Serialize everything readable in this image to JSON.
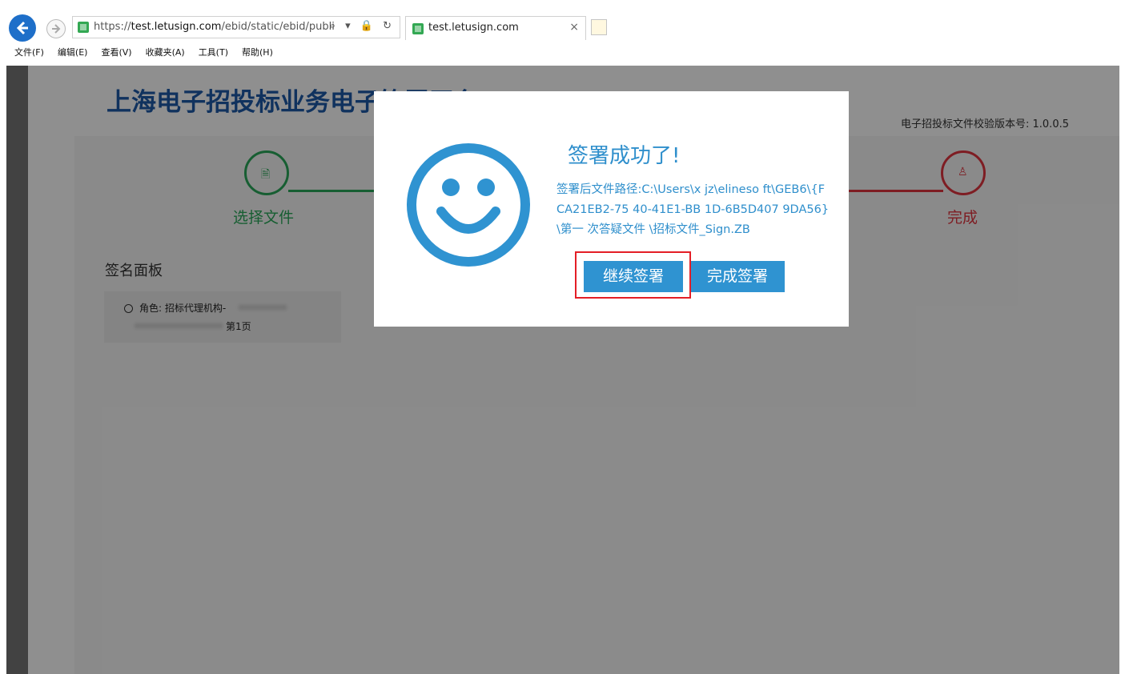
{
  "browser": {
    "url_prefix": "https://",
    "url_host": "test.letusign.com",
    "url_path": "/ebid/static/ebid/publi",
    "address_icons": "⌕ ▾ 🔒 ↻",
    "tab_title": "test.letusign.com",
    "tab_close": "×",
    "menu": [
      "文件(F)",
      "编辑(E)",
      "查看(V)",
      "收藏夹(A)",
      "工具(T)",
      "帮助(H)"
    ]
  },
  "page": {
    "platform_title": "上海电子招投标业务电子签署平台",
    "version": "电子招投标文件校验版本号: 1.0.0.5",
    "steps": {
      "first_label": "选择文件",
      "last_label": "完成",
      "first_icon": "🗎",
      "last_icon": "♙"
    },
    "panel_title": "签名面板",
    "role_label": "角色: 招标代理机构-",
    "role_page": "第1页"
  },
  "modal": {
    "title": "签署成功了!",
    "path_text": "签署后文件路径:C:\\Users\\x jz\\elineso ft\\GEB6\\{F CA21EB2-75 40-41E1-BB 1D-6B5D407 9DA56}\\第一 次答疑文件 \\招标文件_Sign.ZB",
    "continue_button": "继续签署",
    "finish_button": "完成签署"
  },
  "colors": {
    "accent_blue": "#2f93d1",
    "step_green": "#2aa85a",
    "step_red": "#e0353f",
    "highlight_red": "#e41e26",
    "title_blue": "#1e5aa8"
  }
}
